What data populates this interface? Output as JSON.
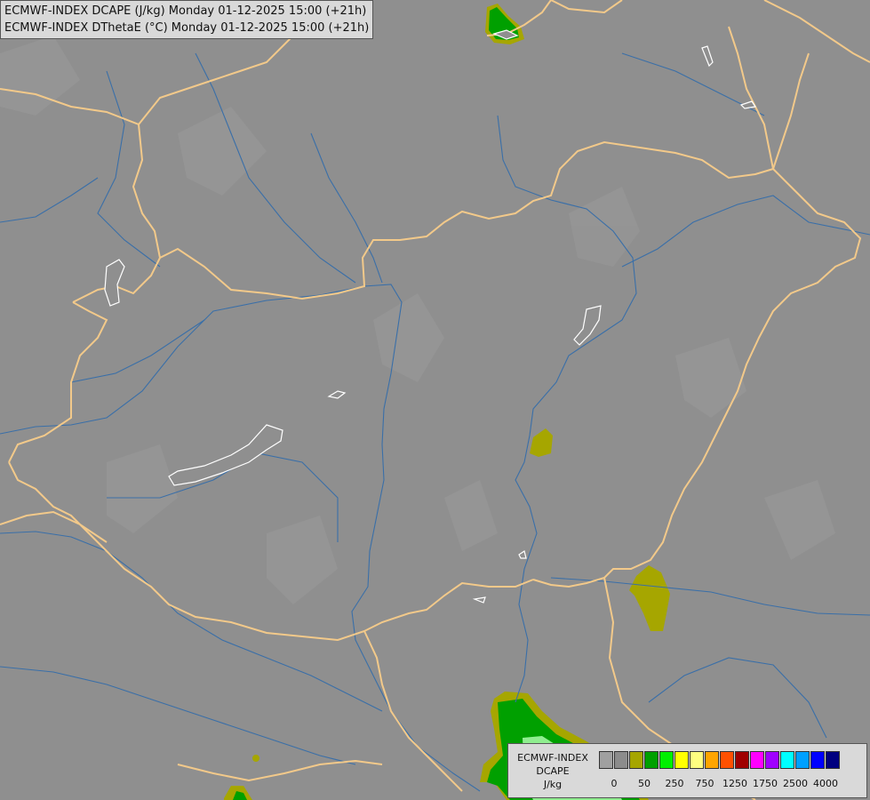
{
  "header": {
    "line1": "ECMWF-INDEX DCAPE (J/kg) Monday 01-12-2025 15:00 (+21h)",
    "line2": "ECMWF-INDEX DThetaE (°C) Monday 01-12-2025 15:00 (+21h)"
  },
  "legend": {
    "title_lines": [
      "ECMWF-INDEX",
      "DCAPE",
      "J/kg"
    ],
    "colors": [
      "#a0a0a0",
      "#8c8c8c",
      "#a6a600",
      "#00a000",
      "#00f000",
      "#ffff00",
      "#ffff80",
      "#ffa500",
      "#ff5000",
      "#a00000",
      "#ff00ff",
      "#a000ff",
      "#00ffff",
      "#00a0ff",
      "#0000ff",
      "#000080"
    ],
    "labels": [
      "0",
      "50",
      "250",
      "750",
      "1250",
      "1750",
      "2500",
      "4000"
    ]
  },
  "map": {
    "background_color": "#8f8f8f",
    "border_color": "#f2c98a",
    "river_color": "#3a6fa8",
    "lake_outline_color": "#ffffff",
    "field_colors": {
      "dcape_50": "#a6a600",
      "dcape_250": "#00a000",
      "dcape_750": "#00f000",
      "dcape_high": "#90ee90"
    }
  }
}
